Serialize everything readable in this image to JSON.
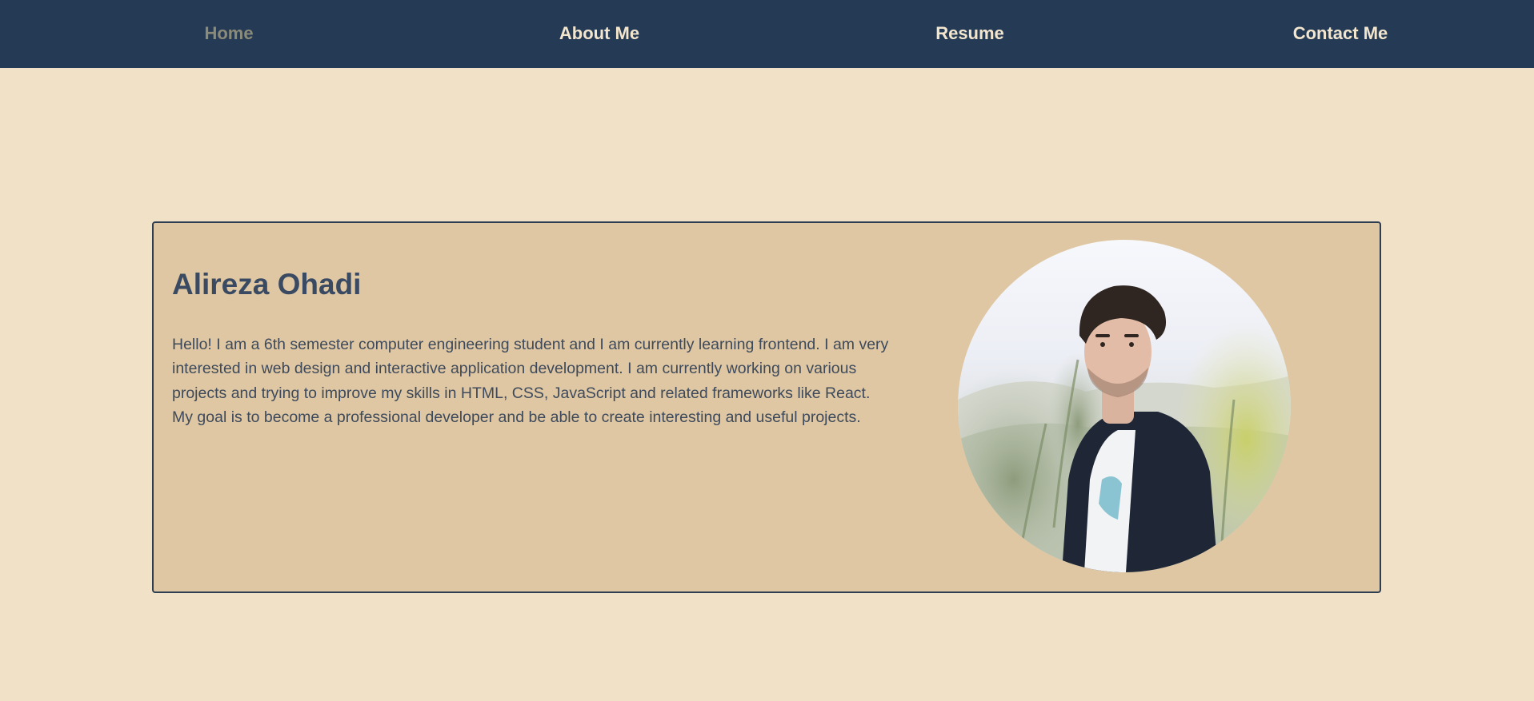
{
  "nav": {
    "items": [
      {
        "label": "Home",
        "active": true
      },
      {
        "label": "About Me",
        "active": false
      },
      {
        "label": "Resume",
        "active": false
      },
      {
        "label": "Contact Me",
        "active": false
      }
    ]
  },
  "profile": {
    "name": "Alireza Ohadi",
    "bio": "Hello! I am a 6th semester computer engineering student and I am currently learning frontend. I am very interested in web design and interactive application development. I am currently working on various projects and trying to improve my skills in HTML, CSS, JavaScript and related frameworks like React. My goal is to become a professional developer and be able to create interesting and useful projects."
  },
  "colors": {
    "page_background": "#f1e1c6",
    "navbar_background": "#253a54",
    "nav_text": "#f3e6cf",
    "nav_active_text": "#8b8b7a",
    "card_background": "#dec7a2",
    "card_border": "#2d3d52",
    "heading_text": "#394a62",
    "body_text": "#3e4a5c"
  }
}
